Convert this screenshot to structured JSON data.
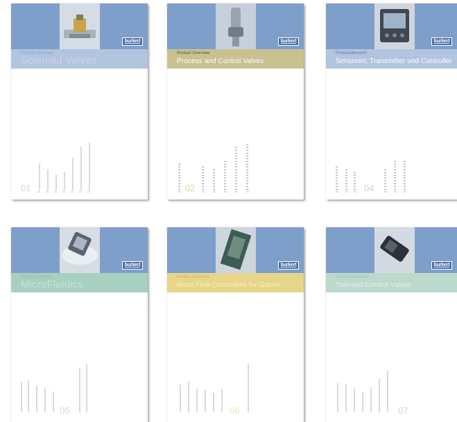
{
  "brand": {
    "logo_text": "burkert"
  },
  "cards": [
    {
      "subtitle": "Product Overview",
      "title": "Solenoid Valves",
      "number": "01",
      "accent": "#b3c4df"
    },
    {
      "subtitle": "Product Overview",
      "title": "Process and Control Valves",
      "number": "02",
      "accent": "#c9c290"
    },
    {
      "subtitle": "Produktübersicht",
      "title": "Sensoren, Transmitter und Controller",
      "number": "04",
      "accent": "#b3c4df"
    },
    {
      "subtitle": "Product Overview",
      "title": "MicroFluidics",
      "number": "05",
      "accent": "#a8d0c0"
    },
    {
      "subtitle": "Product Overview",
      "title": "Mass Flow Controllers for Gases",
      "number": "06",
      "accent": "#e7d68a"
    },
    {
      "subtitle": "Product Overview",
      "title": "Solenoid Control Valves",
      "number": "07",
      "accent": "#bcd9cc"
    }
  ],
  "colors": {
    "header_blue": "#7f9fcb",
    "logo_blue": "#4a6fa8",
    "bar_gray": "#d9d9dc"
  }
}
